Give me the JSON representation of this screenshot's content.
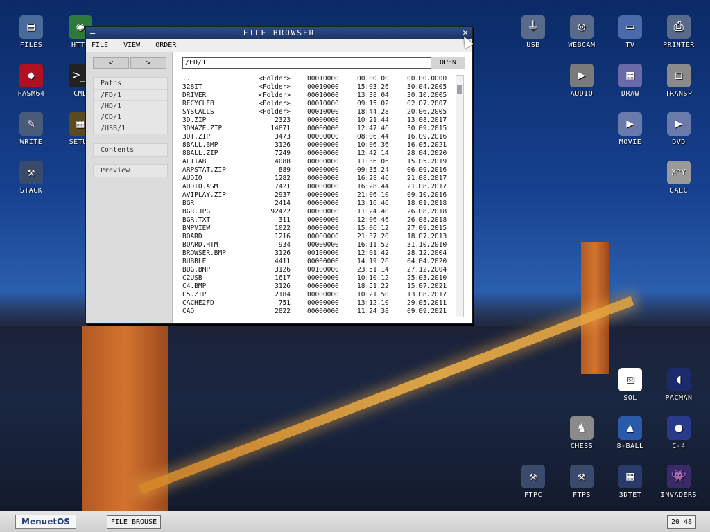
{
  "desktop": {
    "icons": [
      {
        "label": "FILES",
        "icon": "files-icon",
        "glyph": "▤",
        "color": "#4a6a9a"
      },
      {
        "label": "HTTP",
        "icon": "globe-icon",
        "glyph": "◉",
        "color": "#2f7a3a"
      },
      {
        "label": "FASM64",
        "icon": "fasm-icon",
        "glyph": "◆",
        "color": "#b01020"
      },
      {
        "label": "CMD",
        "icon": "terminal-icon",
        "glyph": ">_",
        "color": "#222"
      },
      {
        "label": "WRITE",
        "icon": "pencil-icon",
        "glyph": "✎",
        "color": "#4a5a7a"
      },
      {
        "label": "SETUP",
        "icon": "chip-icon",
        "glyph": "▦",
        "color": "#5a4a20"
      },
      {
        "label": "STACK",
        "icon": "tools-icon",
        "glyph": "⚒",
        "color": "#3a4a6a"
      },
      {
        "label": "USB",
        "icon": "usb-icon",
        "glyph": "⏚",
        "color": "#5a6a8a"
      },
      {
        "label": "WEBCAM",
        "icon": "webcam-icon",
        "glyph": "◎",
        "color": "#5a6a8a"
      },
      {
        "label": "TV",
        "icon": "tv-icon",
        "glyph": "▭",
        "color": "#4a6aaa"
      },
      {
        "label": "PRINTER",
        "icon": "printer-icon",
        "glyph": "⎙",
        "color": "#5a6a8a"
      },
      {
        "label": "AUDIO",
        "icon": "audio-icon",
        "glyph": "▶",
        "color": "#7a7a7a"
      },
      {
        "label": "DRAW",
        "icon": "draw-icon",
        "glyph": "▦",
        "color": "#6a6aaa"
      },
      {
        "label": "TRANSP",
        "icon": "transparency-icon",
        "glyph": "◻",
        "color": "#8a8a8a"
      },
      {
        "label": "MOVIE",
        "icon": "movie-icon",
        "glyph": "▶",
        "color": "#6a7aaa"
      },
      {
        "label": "DVD",
        "icon": "dvd-icon",
        "glyph": "▶",
        "color": "#6a7aaa"
      },
      {
        "label": "CALC",
        "icon": "calculator-icon",
        "glyph": "X^Y",
        "color": "#9a9a9a"
      },
      {
        "label": "SOL",
        "icon": "solitaire-icon",
        "glyph": "⚄",
        "color": "#ffffff"
      },
      {
        "label": "PACMAN",
        "icon": "pacman-icon",
        "glyph": "◖",
        "color": "#1a2a6a"
      },
      {
        "label": "CHESS",
        "icon": "chess-icon",
        "glyph": "♞",
        "color": "#8a8a8a"
      },
      {
        "label": "8-BALL",
        "icon": "billiards-icon",
        "glyph": "▲",
        "color": "#2a5aaa"
      },
      {
        "label": "C-4",
        "icon": "connect-four-icon",
        "glyph": "●",
        "color": "#2a3a8a"
      },
      {
        "label": "FTPC",
        "icon": "tools-icon",
        "glyph": "⚒",
        "color": "#3a4a6a"
      },
      {
        "label": "FTPS",
        "icon": "tools-icon",
        "glyph": "⚒",
        "color": "#3a4a6a"
      },
      {
        "label": "3DTET",
        "icon": "tetris-icon",
        "glyph": "▦",
        "color": "#2a3a6a"
      },
      {
        "label": "INVADERS",
        "icon": "invaders-icon",
        "glyph": "👾",
        "color": "#3a2a6a"
      }
    ]
  },
  "window": {
    "title": "FILE BROWSER",
    "minimize": "—",
    "close": "✕",
    "menu": [
      "FILE",
      "VIEW",
      "ORDER"
    ],
    "nav": {
      "back": "<",
      "forward": ">"
    },
    "sidebar": {
      "paths_label": "Paths",
      "paths": [
        "/FD/1",
        "/HD/1",
        "/CD/1",
        "/USB/1"
      ],
      "contents_label": "Contents",
      "preview_label": "Preview"
    },
    "path_value": "/FD/1",
    "open_label": "OPEN",
    "files": [
      {
        "name": "..",
        "size": "<Folder>",
        "attr": "00010000",
        "time": "00.00.00",
        "date": "00.00.0000"
      },
      {
        "name": "32BIT",
        "size": "<Folder>",
        "attr": "00010000",
        "time": "15:03.26",
        "date": "30.04.2005"
      },
      {
        "name": "DRIVER",
        "size": "<Folder>",
        "attr": "00010000",
        "time": "13:38.04",
        "date": "30.10.2005"
      },
      {
        "name": "RECYCLEB",
        "size": "<Folder>",
        "attr": "00010000",
        "time": "09:15.02",
        "date": "02.07.2007"
      },
      {
        "name": "SYSCALLS",
        "size": "<Folder>",
        "attr": "00010000",
        "time": "18:44.28",
        "date": "20.06.2005"
      },
      {
        "name": "3D.ZIP",
        "size": "2323",
        "attr": "00000000",
        "time": "10:21.44",
        "date": "13.08.2017"
      },
      {
        "name": "3DMAZE.ZIP",
        "size": "14871",
        "attr": "00000000",
        "time": "12:47.46",
        "date": "30.09.2015"
      },
      {
        "name": "3DT.ZIP",
        "size": "3473",
        "attr": "00000000",
        "time": "08:06.44",
        "date": "16.09.2016"
      },
      {
        "name": "8BALL.BMP",
        "size": "3126",
        "attr": "00000000",
        "time": "10:06.36",
        "date": "16.05.2021"
      },
      {
        "name": "8BALL.ZIP",
        "size": "7249",
        "attr": "00000000",
        "time": "12:42.14",
        "date": "28.04.2020"
      },
      {
        "name": "ALTTAB",
        "size": "4088",
        "attr": "00000000",
        "time": "11:36.06",
        "date": "15.05.2019"
      },
      {
        "name": "ARPSTAT.ZIP",
        "size": "889",
        "attr": "00000000",
        "time": "09:35.24",
        "date": "06.09.2016"
      },
      {
        "name": "AUDIO",
        "size": "1282",
        "attr": "00000000",
        "time": "16:28.46",
        "date": "21.08.2017"
      },
      {
        "name": "AUDIO.ASM",
        "size": "7421",
        "attr": "00000000",
        "time": "16:28.44",
        "date": "21.08.2017"
      },
      {
        "name": "AVIPLAY.ZIP",
        "size": "2937",
        "attr": "00000000",
        "time": "21:06.10",
        "date": "09.10.2016"
      },
      {
        "name": "BGR",
        "size": "2414",
        "attr": "00000000",
        "time": "13:16.46",
        "date": "18.01.2018"
      },
      {
        "name": "BGR.JPG",
        "size": "92422",
        "attr": "00000000",
        "time": "11:24.40",
        "date": "26.08.2018"
      },
      {
        "name": "BGR.TXT",
        "size": "311",
        "attr": "00000000",
        "time": "12:06.46",
        "date": "26.08.2018"
      },
      {
        "name": "BMPVIEW",
        "size": "1022",
        "attr": "00000000",
        "time": "15:06.12",
        "date": "27.09.2015"
      },
      {
        "name": "BOARD",
        "size": "1216",
        "attr": "00000000",
        "time": "21:37.20",
        "date": "18.07.2013"
      },
      {
        "name": "BOARD.HTM",
        "size": "934",
        "attr": "00000000",
        "time": "16:11.52",
        "date": "31.10.2010"
      },
      {
        "name": "BROWSER.BMP",
        "size": "3126",
        "attr": "00100000",
        "time": "12:01.42",
        "date": "28.12.2004"
      },
      {
        "name": "BUBBLE",
        "size": "4411",
        "attr": "00000000",
        "time": "14:19.26",
        "date": "04.04.2020"
      },
      {
        "name": "BUG.BMP",
        "size": "3126",
        "attr": "00100000",
        "time": "23:51.14",
        "date": "27.12.2004"
      },
      {
        "name": "C2USB",
        "size": "1617",
        "attr": "00000000",
        "time": "10:10.12",
        "date": "25.03.2010"
      },
      {
        "name": "C4.BMP",
        "size": "3126",
        "attr": "00000000",
        "time": "18:51.22",
        "date": "15.07.2021"
      },
      {
        "name": "C5.ZIP",
        "size": "2184",
        "attr": "00000000",
        "time": "10:21.50",
        "date": "13.08.2017"
      },
      {
        "name": "CACHE2FD",
        "size": "751",
        "attr": "00000000",
        "time": "13:12.10",
        "date": "29.05.2011"
      },
      {
        "name": "CAD",
        "size": "2822",
        "attr": "00000000",
        "time": "11:24.38",
        "date": "09.09.2021"
      }
    ]
  },
  "taskbar": {
    "start_label": "MenuetOS",
    "task_label": "FILE BROUSE",
    "clock": "20 48"
  }
}
